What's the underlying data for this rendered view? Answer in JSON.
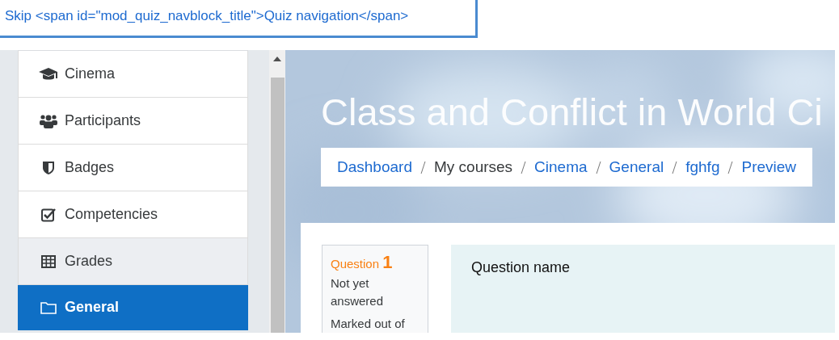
{
  "skip_link": {
    "text": "Skip <span id=\"mod_quiz_navblock_title\">Quiz navigation</span>"
  },
  "nav": {
    "items": [
      {
        "label": "Cinema",
        "selected": false,
        "hovered": false
      },
      {
        "label": "Participants",
        "selected": false,
        "hovered": false
      },
      {
        "label": "Badges",
        "selected": false,
        "hovered": false
      },
      {
        "label": "Competencies",
        "selected": false,
        "hovered": false
      },
      {
        "label": "Grades",
        "selected": false,
        "hovered": true
      },
      {
        "label": "General",
        "selected": true,
        "hovered": false
      }
    ]
  },
  "header": {
    "title": "Class and Conflict in World Ci",
    "breadcrumb": [
      {
        "label": "Dashboard",
        "link": true
      },
      {
        "label": "My courses",
        "link": false
      },
      {
        "label": "Cinema",
        "link": true
      },
      {
        "label": "General",
        "link": true
      },
      {
        "label": "fghfg",
        "link": true
      },
      {
        "label": "Preview",
        "link": true
      }
    ]
  },
  "question": {
    "label": "Question",
    "number": "1",
    "status": "Not yet answered",
    "marks": "Marked out of",
    "name": "Question name"
  }
}
